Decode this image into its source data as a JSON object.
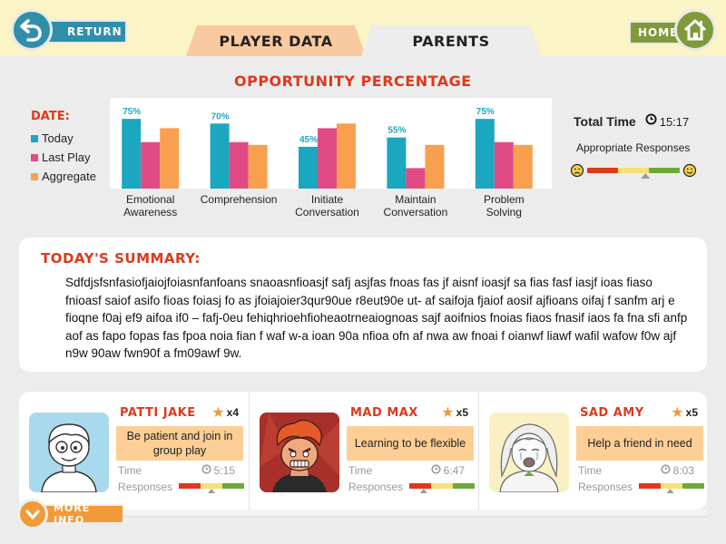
{
  "nav": {
    "return_label": "RETURN",
    "home_label": "HOME",
    "tabs": [
      {
        "label": "PLAYER DATA",
        "active": false
      },
      {
        "label": "PARENTS",
        "active": true
      }
    ]
  },
  "opportunity": {
    "title": "OPPORTUNITY PERCENTAGE",
    "legend_title": "DATE:"
  },
  "chart_data": {
    "type": "bar",
    "title": "OPPORTUNITY PERCENTAGE",
    "legend_placement": "left",
    "grid": false,
    "ylim": [
      0,
      80
    ],
    "categories": [
      "Emotional\nAwareness",
      "Comprehension",
      "Initiate\nConversation",
      "Maintain\nConversation",
      "Problem\nSolving"
    ],
    "series": [
      {
        "name": "Today",
        "color": "#1ba7c0",
        "values": [
          75,
          70,
          45,
          55,
          75
        ]
      },
      {
        "name": "Last Play",
        "color": "#e04b86",
        "values": [
          50,
          50,
          65,
          22,
          50
        ]
      },
      {
        "name": "Aggregate",
        "color": "#f8a04f",
        "values": [
          65,
          47,
          70,
          47,
          47
        ]
      }
    ],
    "data_labels": [
      "75%",
      "70%",
      "45%",
      "55%",
      "75%"
    ]
  },
  "stats": {
    "total_time_label": "Total Time",
    "total_time": "15:17",
    "appropriate_label": "Appropriate Responses",
    "appropriate_level": 0.63
  },
  "summary": {
    "title": "TODAY'S SUMMARY:",
    "text": "Sdfdjsfsnfasiofjaiojfoiasnfanfoans snaoasnfioasjf safj asjfas fnoas fas jf aisnf ioasjf sa fias fasf iasjf ioas fiaso fnioasf saiof asifo  fioas foiasj fo as jfoiajoier3qur90ue r8eut90e ut- af saifoja fjaiof aosif ajfioans oifaj f sanfm arj e fioqne f0aj ef9 aifoa if0 – fafj-0eu fehiqhrioehfioheaotrneaiognoas sajf aoifnios fnoias fiaos fnasif iaos fa fna sfi anfp aof as fapo fopas fas fpoa noia fian f waf w-a ioan 90a nfioa ofn af nwa aw fnoai f oianwf liawf wafil wafow f0w ajf n9w 90aw fwn90f a fm09awf 9w."
  },
  "players": [
    {
      "name": "PATTI JAKE",
      "stars": "x4",
      "goal": "Be patient and join in group play",
      "time_label": "Time",
      "time": "5:15",
      "responses_label": "Responses",
      "responses_level": 0.5
    },
    {
      "name": "MAD MAX",
      "stars": "x5",
      "goal": "Learning to be flexible",
      "time_label": "Time",
      "time": "6:47",
      "responses_label": "Responses",
      "responses_level": 0.22
    },
    {
      "name": "SAD AMY",
      "stars": "x5",
      "goal": "Help a friend in need",
      "time_label": "Time",
      "time": "8:03",
      "responses_label": "Responses",
      "responses_level": 0.48
    }
  ],
  "more_info_label": "MORE INFO",
  "colors": {
    "accent_red": "#e0381c",
    "return_blue": "#2f8fab",
    "home_green": "#7f9a3b",
    "orange": "#f29a37",
    "goal_bg": "#fdcf96",
    "top_bar": "#fbf4c6"
  }
}
